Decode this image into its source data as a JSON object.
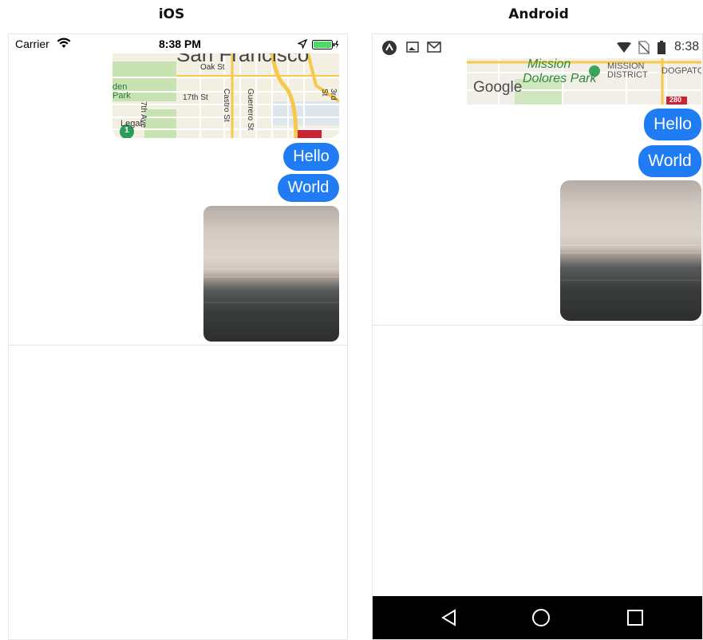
{
  "headings": {
    "ios": "iOS",
    "android": "Android"
  },
  "ios": {
    "status": {
      "carrier": "Carrier",
      "time": "8:38 PM"
    },
    "map": {
      "labels": {
        "city": "San Francisco",
        "oak": "Oak St",
        "park": "Park",
        "golden": "den",
        "seventh": "7th Ave",
        "seventeenth": "17th St",
        "castro": "Castro St",
        "guerrero": "Guerrero St",
        "third": "3rd St",
        "legal": "Legal",
        "route": "1"
      }
    },
    "messages": [
      {
        "text": "Hello"
      },
      {
        "text": "World"
      }
    ]
  },
  "android": {
    "status": {
      "time": "8:38"
    },
    "map": {
      "labels": {
        "mission": "Mission",
        "dolores": "Dolores Park",
        "district1": "MISSION",
        "district2": "DISTRICT",
        "dogpatch": "DOGPATCH",
        "google": "Google",
        "route": "280"
      }
    },
    "messages": [
      {
        "text": "Hello"
      },
      {
        "text": "World"
      }
    ]
  },
  "colors": {
    "bubble": "#1f7cf2",
    "battery": "#4cd964",
    "navbar": "#000000"
  }
}
